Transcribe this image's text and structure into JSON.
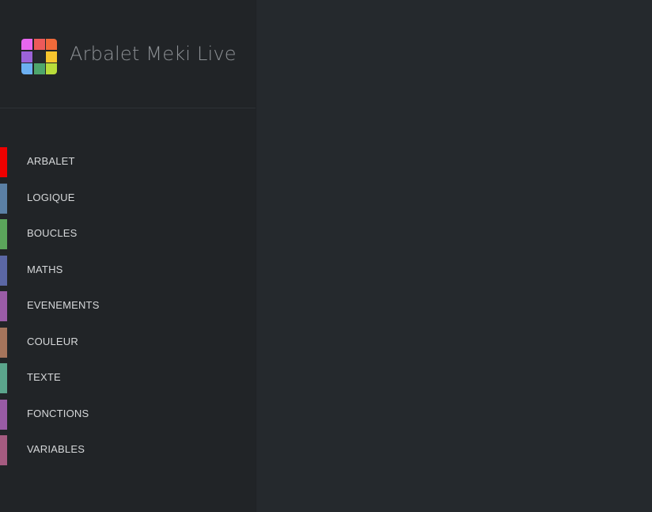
{
  "header": {
    "title": "Arbalet Meki Live",
    "logo_colors": [
      "#e867f0",
      "#ec5a5a",
      "#f06a3a",
      "#9b63d8",
      "#25292d",
      "#f7c52e",
      "#6cb0f2",
      "#4ea66c",
      "#b9dc3a"
    ]
  },
  "menu": {
    "items": [
      {
        "label": "ARBALET",
        "color": "#ee0000"
      },
      {
        "label": "LOGIQUE",
        "color": "#5b80a5"
      },
      {
        "label": "BOUCLES",
        "color": "#5ba55b"
      },
      {
        "label": "MATHS",
        "color": "#5b67a5"
      },
      {
        "label": "EVENEMENTS",
        "color": "#9a5ca6"
      },
      {
        "label": "COULEUR",
        "color": "#a5745b"
      },
      {
        "label": "TEXTE",
        "color": "#5ba58c"
      },
      {
        "label": "FONCTIONS",
        "color": "#995ba5"
      },
      {
        "label": "VARIABLES",
        "color": "#a55b80"
      }
    ]
  }
}
